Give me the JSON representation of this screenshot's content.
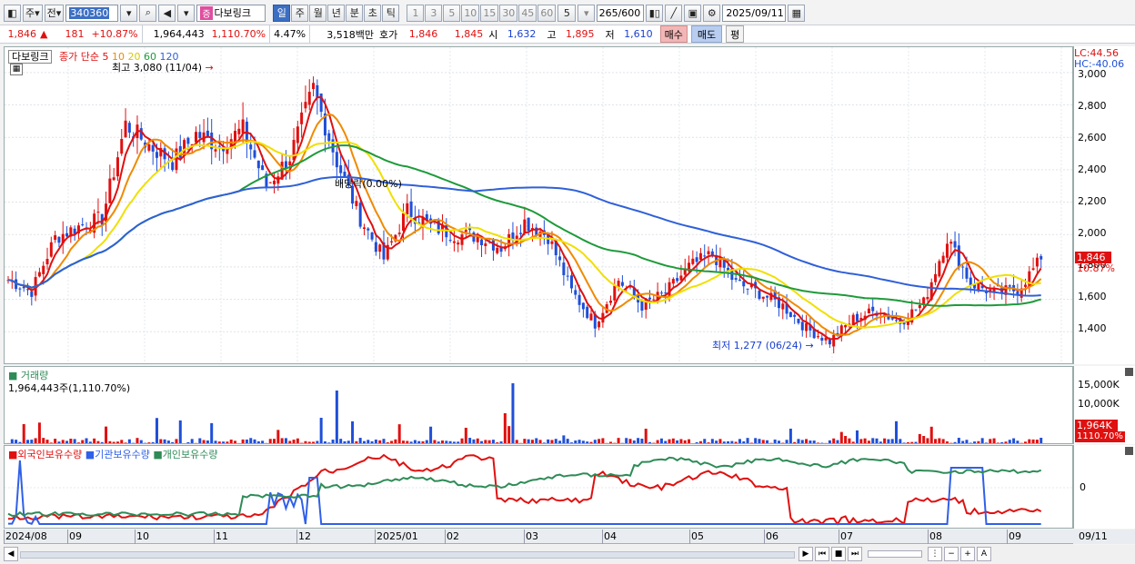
{
  "toolbar": {
    "period_main": "주",
    "prev_label": "전",
    "stock_code": "340360",
    "stock_name": "다보링크",
    "badge": "증",
    "period_tabs": [
      "일",
      "주",
      "월",
      "년",
      "분",
      "초",
      "틱"
    ],
    "active_period": "일",
    "minute_buttons": [
      "1",
      "3",
      "5",
      "10",
      "15",
      "30",
      "45",
      "60"
    ],
    "selected_interval": "5",
    "count": "265/600",
    "date": "2025/09/11"
  },
  "price_row": {
    "price": "1,846",
    "change_sign": "▲",
    "change": "181",
    "change_pct": "+10.87%",
    "volume": "1,964,443",
    "volume_ratio": "1,110.70%",
    "turnover": "4.47%",
    "amount": "3,518백만",
    "bid_label": "호가",
    "ask_price": "1,846",
    "bid_price": "1,845",
    "open_label": "시",
    "open": "1,632",
    "high_label": "고",
    "high": "1,895",
    "low_label": "저",
    "low": "1,610",
    "buy_label": "매수",
    "sell_label": "매도",
    "eval_label": "평"
  },
  "price_pane": {
    "stock_tab": "다보링크",
    "ma_label": "종가 단순",
    "ma_periods": [
      "5",
      "10",
      "20",
      "60",
      "120"
    ],
    "high_annotation": "최고 3,080 (11/04)",
    "low_annotation": "최저 1,277 (06/24)",
    "event_label": "배당락(0.00%)",
    "lc": "LC:44.56",
    "hc": "HC:-40.06",
    "current_price_tag": "1,846",
    "current_pct_tag": "10.87%",
    "y_ticks": [
      "3,000",
      "2,800",
      "2,600",
      "2,400",
      "2,200",
      "2,000",
      "1,800",
      "1,600",
      "1,400"
    ]
  },
  "volume_pane": {
    "title": "거래량",
    "value": "1,964,443주(1,110.70%)",
    "y_ticks": [
      "15,000K",
      "10,000K"
    ],
    "current_tag": "1,964K",
    "pct_tag": "1110.70%"
  },
  "holding_pane": {
    "legend": [
      "외국인보유수량",
      "기관보유수량",
      "개인보유수량"
    ],
    "zero_tick": "0"
  },
  "date_axis": [
    "2024/08",
    "09",
    "10",
    "11",
    "12",
    "2025/01",
    "02",
    "03",
    "04",
    "05",
    "06",
    "07",
    "08",
    "09"
  ],
  "date_axis_right": "09/11",
  "colors": {
    "up": "#e01010",
    "down": "#1f4fd8",
    "ma5": "#e01010",
    "ma10": "#f08a00",
    "ma20": "#f0e000",
    "ma60": "#1e9a3a",
    "ma120": "#3060d8",
    "foreign": "#e01010",
    "institution": "#3060e8",
    "individual": "#2e8b57"
  },
  "chart_data": {
    "type": "candlestick",
    "title": "다보링크 일봉",
    "ylim": [
      1250,
      3100
    ],
    "price_path": [
      [
        "2024/08",
        1720
      ],
      [
        "2024/08",
        1650
      ],
      [
        "09",
        1980
      ],
      [
        "09",
        2050
      ],
      [
        "09",
        2100
      ],
      [
        "10",
        2680
      ],
      [
        "10",
        2550
      ],
      [
        "10",
        2450
      ],
      [
        "10",
        2620
      ],
      [
        "10",
        2550
      ],
      [
        "11",
        2650
      ],
      [
        "11",
        2300
      ],
      [
        "11",
        2480
      ],
      [
        "11",
        2900
      ],
      [
        "11",
        2450
      ],
      [
        "12",
        2100
      ],
      [
        "12",
        1850
      ],
      [
        "12",
        2150
      ],
      [
        "12",
        2050
      ],
      [
        "12",
        2000
      ],
      [
        "2025/01",
        1990
      ],
      [
        "2025/01",
        1920
      ],
      [
        "02",
        2080
      ],
      [
        "02",
        1990
      ],
      [
        "03",
        1650
      ],
      [
        "03",
        1450
      ],
      [
        "03",
        1720
      ],
      [
        "04",
        1560
      ],
      [
        "04",
        1640
      ],
      [
        "04",
        1800
      ],
      [
        "05",
        1880
      ],
      [
        "05",
        1700
      ],
      [
        "05",
        1640
      ],
      [
        "06",
        1560
      ],
      [
        "06",
        1420
      ],
      [
        "06",
        1340
      ],
      [
        "07",
        1480
      ],
      [
        "07",
        1530
      ],
      [
        "07",
        1460
      ],
      [
        "08",
        1580
      ],
      [
        "08",
        1980
      ],
      [
        "08",
        1700
      ],
      [
        "08",
        1640
      ],
      [
        "09",
        1660
      ],
      [
        "09",
        1846
      ]
    ]
  }
}
